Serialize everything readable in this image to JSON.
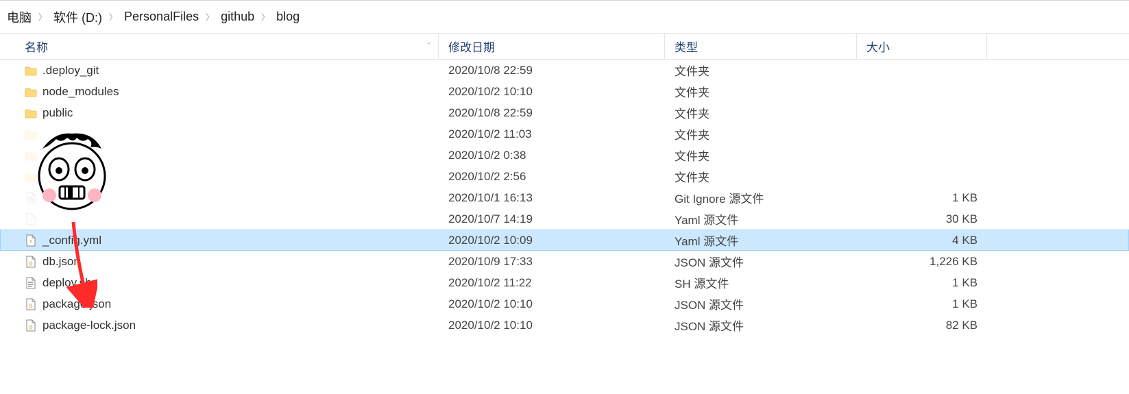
{
  "breadcrumb": [
    "电脑",
    "软件 (D:)",
    "PersonalFiles",
    "github",
    "blog"
  ],
  "columns": {
    "name": "名称",
    "modified": "修改日期",
    "type": "类型",
    "size": "大小"
  },
  "rows": [
    {
      "icon": "folder",
      "name": ".deploy_git",
      "modified": "2020/10/8 22:59",
      "type": "文件夹",
      "size": "",
      "selected": false,
      "obscured": false
    },
    {
      "icon": "folder",
      "name": "node_modules",
      "modified": "2020/10/2 10:10",
      "type": "文件夹",
      "size": "",
      "selected": false,
      "obscured": false
    },
    {
      "icon": "folder",
      "name": "public",
      "modified": "2020/10/8 22:59",
      "type": "文件夹",
      "size": "",
      "selected": false,
      "obscured": false
    },
    {
      "icon": "folder",
      "name": "",
      "modified": "2020/10/2 11:03",
      "type": "文件夹",
      "size": "",
      "selected": false,
      "obscured": true
    },
    {
      "icon": "folder",
      "name": "",
      "modified": "2020/10/2 0:38",
      "type": "文件夹",
      "size": "",
      "selected": false,
      "obscured": true
    },
    {
      "icon": "folder",
      "name": "",
      "modified": "2020/10/2 2:56",
      "type": "文件夹",
      "size": "",
      "selected": false,
      "obscured": true
    },
    {
      "icon": "gear",
      "name": "",
      "modified": "2020/10/1 16:13",
      "type": "Git Ignore 源文件",
      "size": "1 KB",
      "selected": false,
      "obscured": true
    },
    {
      "icon": "yaml",
      "name": "",
      "modified": "2020/10/7 14:19",
      "type": "Yaml 源文件",
      "size": "30 KB",
      "selected": false,
      "obscured": true
    },
    {
      "icon": "yaml",
      "name": "_config.yml",
      "modified": "2020/10/2 10:09",
      "type": "Yaml 源文件",
      "size": "4 KB",
      "selected": true,
      "obscured": false
    },
    {
      "icon": "json",
      "name": "db.json",
      "modified": "2020/10/9 17:33",
      "type": "JSON 源文件",
      "size": "1,226 KB",
      "selected": false,
      "obscured": false
    },
    {
      "icon": "sh",
      "name": "deploy.sh",
      "modified": "2020/10/2 11:22",
      "type": "SH 源文件",
      "size": "1 KB",
      "selected": false,
      "obscured": false
    },
    {
      "icon": "json",
      "name": "package.json",
      "modified": "2020/10/2 10:10",
      "type": "JSON 源文件",
      "size": "1 KB",
      "selected": false,
      "obscured": false
    },
    {
      "icon": "json",
      "name": "package-lock.json",
      "modified": "2020/10/2 10:10",
      "type": "JSON 源文件",
      "size": "82 KB",
      "selected": false,
      "obscured": false
    }
  ],
  "annotation": {
    "arrow_points_to": "_config.yml"
  }
}
